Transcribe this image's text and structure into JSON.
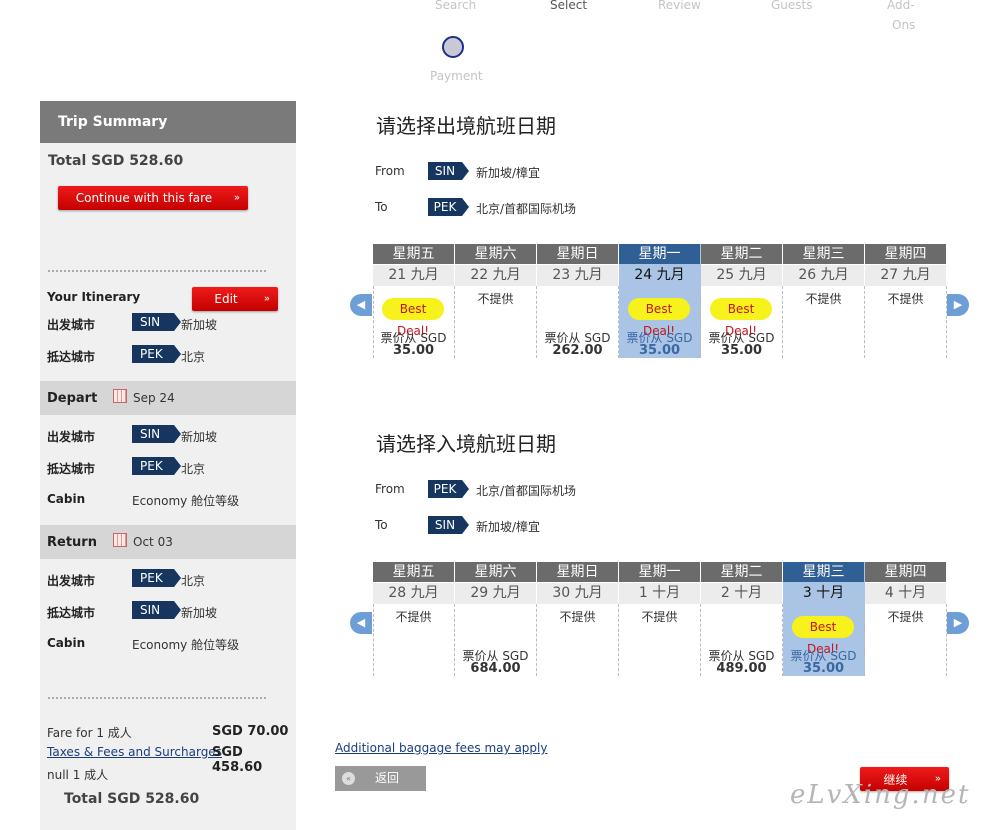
{
  "steps": [
    "Search",
    "Select",
    "Review",
    "Guests",
    "Add-",
    "Ons",
    "Payment"
  ],
  "sidebar": {
    "title": "Trip Summary",
    "total_top": "Total SGD 528.60",
    "continue_label": "Continue with this fare",
    "itinerary_label": "Your Itinerary",
    "edit_label": "Edit",
    "origin_label": "出发城市",
    "dest_label": "抵达城市",
    "cabin_label": "Cabin",
    "overview": {
      "origin_code": "SIN",
      "origin_city": "新加坡",
      "dest_code": "PEK",
      "dest_city": "北京"
    },
    "depart": {
      "label": "Depart",
      "date": "Sep 24",
      "origin_code": "SIN",
      "origin_city": "新加坡",
      "dest_code": "PEK",
      "dest_city": "北京",
      "cabin": "Economy 舱位等级"
    },
    "return": {
      "label": "Return",
      "date": "Oct 03",
      "origin_code": "PEK",
      "origin_city": "北京",
      "dest_code": "SIN",
      "dest_city": "新加坡",
      "cabin": "Economy 舱位等级"
    },
    "fare_label": "Fare for 1 成人",
    "fare_value": "SGD 70.00",
    "taxes_label": "Taxes & Fees and Surcharges",
    "taxes_value": "SGD 458.60",
    "null_label": "null 1 成人",
    "total_bottom": "Total SGD 528.60"
  },
  "outbound": {
    "heading": "请选择出境航班日期",
    "from_label": "From",
    "from_code": "SIN",
    "from_city": "新加坡/樟宜",
    "to_label": "To",
    "to_code": "PEK",
    "to_city": "北京/首都国际机场",
    "days": [
      {
        "weekday": "星期五",
        "date": "21 九月",
        "deal": "Best Deal!",
        "na": "",
        "price_from": "票价从 SGD",
        "price": "35.00",
        "selected": false
      },
      {
        "weekday": "星期六",
        "date": "22 九月",
        "deal": "",
        "na": "不提供",
        "price_from": "",
        "price": "",
        "selected": false
      },
      {
        "weekday": "星期日",
        "date": "23 九月",
        "deal": "",
        "na": "",
        "price_from": "票价从 SGD",
        "price": "262.00",
        "selected": false
      },
      {
        "weekday": "星期一",
        "date": "24 九月",
        "deal": "Best Deal!",
        "na": "",
        "price_from": "票价从 SGD",
        "price": "35.00",
        "selected": true
      },
      {
        "weekday": "星期二",
        "date": "25 九月",
        "deal": "Best Deal!",
        "na": "",
        "price_from": "票价从 SGD",
        "price": "35.00",
        "selected": false
      },
      {
        "weekday": "星期三",
        "date": "26 九月",
        "deal": "",
        "na": "不提供",
        "price_from": "",
        "price": "",
        "selected": false
      },
      {
        "weekday": "星期四",
        "date": "27 九月",
        "deal": "",
        "na": "不提供",
        "price_from": "",
        "price": "",
        "selected": false
      }
    ]
  },
  "inbound": {
    "heading": "请选择入境航班日期",
    "from_label": "From",
    "from_code": "PEK",
    "from_city": "北京/首都国际机场",
    "to_label": "To",
    "to_code": "SIN",
    "to_city": "新加坡/樟宜",
    "days": [
      {
        "weekday": "星期五",
        "date": "28 九月",
        "deal": "",
        "na": "不提供",
        "price_from": "",
        "price": "",
        "selected": false
      },
      {
        "weekday": "星期六",
        "date": "29 九月",
        "deal": "",
        "na": "",
        "price_from": "票价从 SGD",
        "price": "684.00",
        "selected": false
      },
      {
        "weekday": "星期日",
        "date": "30 九月",
        "deal": "",
        "na": "不提供",
        "price_from": "",
        "price": "",
        "selected": false
      },
      {
        "weekday": "星期一",
        "date": "1 十月",
        "deal": "",
        "na": "不提供",
        "price_from": "",
        "price": "",
        "selected": false
      },
      {
        "weekday": "星期二",
        "date": "2 十月",
        "deal": "",
        "na": "",
        "price_from": "票价从 SGD",
        "price": "489.00",
        "selected": false
      },
      {
        "weekday": "星期三",
        "date": "3 十月",
        "deal": "Best Deal!",
        "na": "",
        "price_from": "票价从 SGD",
        "price": "35.00",
        "selected": true
      },
      {
        "weekday": "星期四",
        "date": "4 十月",
        "deal": "",
        "na": "不提供",
        "price_from": "",
        "price": "",
        "selected": false
      }
    ]
  },
  "baggage_link": "Additional baggage fees may apply",
  "back_label": "返回",
  "continue_main_label": "继续",
  "watermark": "eLvXing.net",
  "colors": {
    "brand_red": "#e00000",
    "navy": "#16365f",
    "selected_day": "#a9c4e4",
    "deal_yellow": "#f7f21b",
    "arrow_blue": "#6d9fd6"
  }
}
